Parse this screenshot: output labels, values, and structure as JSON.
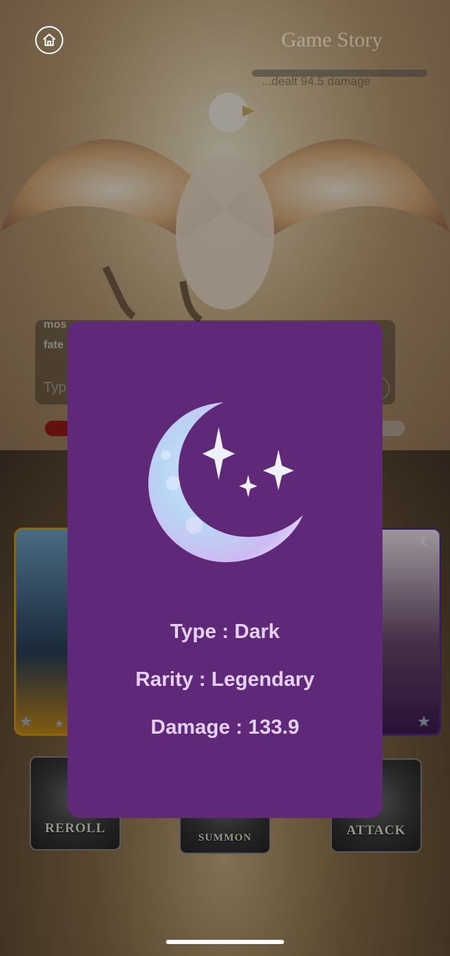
{
  "header": {
    "title": "Game Story",
    "home_icon": "home-icon",
    "damage_log": "...dealt 94.5 damage"
  },
  "chat": {
    "lines": [
      "mos",
      "fate"
    ],
    "input_placeholder": "Typ"
  },
  "actions": [
    {
      "label": "REROLL"
    },
    {
      "label": "SUMMON"
    },
    {
      "label": "ATTACK"
    }
  ],
  "card_detail": {
    "icon": "crescent-moon-stars-icon",
    "type_text": "Type : Dark",
    "rarity_text": "Rarity : Legendary",
    "damage_text": "Damage : 133.9",
    "background_color": "#5f2878"
  }
}
